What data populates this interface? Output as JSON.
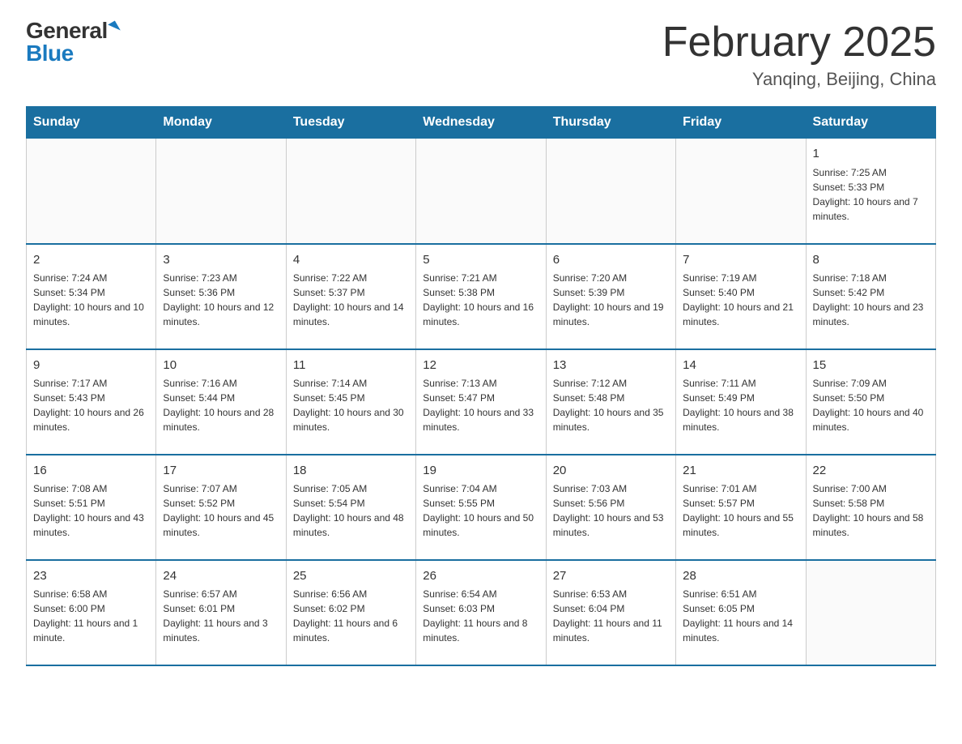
{
  "header": {
    "logo_general": "General",
    "logo_blue": "Blue",
    "month_title": "February 2025",
    "location": "Yanqing, Beijing, China"
  },
  "weekdays": [
    "Sunday",
    "Monday",
    "Tuesday",
    "Wednesday",
    "Thursday",
    "Friday",
    "Saturday"
  ],
  "weeks": [
    [
      {
        "day": "",
        "info": ""
      },
      {
        "day": "",
        "info": ""
      },
      {
        "day": "",
        "info": ""
      },
      {
        "day": "",
        "info": ""
      },
      {
        "day": "",
        "info": ""
      },
      {
        "day": "",
        "info": ""
      },
      {
        "day": "1",
        "info": "Sunrise: 7:25 AM\nSunset: 5:33 PM\nDaylight: 10 hours and 7 minutes."
      }
    ],
    [
      {
        "day": "2",
        "info": "Sunrise: 7:24 AM\nSunset: 5:34 PM\nDaylight: 10 hours and 10 minutes."
      },
      {
        "day": "3",
        "info": "Sunrise: 7:23 AM\nSunset: 5:36 PM\nDaylight: 10 hours and 12 minutes."
      },
      {
        "day": "4",
        "info": "Sunrise: 7:22 AM\nSunset: 5:37 PM\nDaylight: 10 hours and 14 minutes."
      },
      {
        "day": "5",
        "info": "Sunrise: 7:21 AM\nSunset: 5:38 PM\nDaylight: 10 hours and 16 minutes."
      },
      {
        "day": "6",
        "info": "Sunrise: 7:20 AM\nSunset: 5:39 PM\nDaylight: 10 hours and 19 minutes."
      },
      {
        "day": "7",
        "info": "Sunrise: 7:19 AM\nSunset: 5:40 PM\nDaylight: 10 hours and 21 minutes."
      },
      {
        "day": "8",
        "info": "Sunrise: 7:18 AM\nSunset: 5:42 PM\nDaylight: 10 hours and 23 minutes."
      }
    ],
    [
      {
        "day": "9",
        "info": "Sunrise: 7:17 AM\nSunset: 5:43 PM\nDaylight: 10 hours and 26 minutes."
      },
      {
        "day": "10",
        "info": "Sunrise: 7:16 AM\nSunset: 5:44 PM\nDaylight: 10 hours and 28 minutes."
      },
      {
        "day": "11",
        "info": "Sunrise: 7:14 AM\nSunset: 5:45 PM\nDaylight: 10 hours and 30 minutes."
      },
      {
        "day": "12",
        "info": "Sunrise: 7:13 AM\nSunset: 5:47 PM\nDaylight: 10 hours and 33 minutes."
      },
      {
        "day": "13",
        "info": "Sunrise: 7:12 AM\nSunset: 5:48 PM\nDaylight: 10 hours and 35 minutes."
      },
      {
        "day": "14",
        "info": "Sunrise: 7:11 AM\nSunset: 5:49 PM\nDaylight: 10 hours and 38 minutes."
      },
      {
        "day": "15",
        "info": "Sunrise: 7:09 AM\nSunset: 5:50 PM\nDaylight: 10 hours and 40 minutes."
      }
    ],
    [
      {
        "day": "16",
        "info": "Sunrise: 7:08 AM\nSunset: 5:51 PM\nDaylight: 10 hours and 43 minutes."
      },
      {
        "day": "17",
        "info": "Sunrise: 7:07 AM\nSunset: 5:52 PM\nDaylight: 10 hours and 45 minutes."
      },
      {
        "day": "18",
        "info": "Sunrise: 7:05 AM\nSunset: 5:54 PM\nDaylight: 10 hours and 48 minutes."
      },
      {
        "day": "19",
        "info": "Sunrise: 7:04 AM\nSunset: 5:55 PM\nDaylight: 10 hours and 50 minutes."
      },
      {
        "day": "20",
        "info": "Sunrise: 7:03 AM\nSunset: 5:56 PM\nDaylight: 10 hours and 53 minutes."
      },
      {
        "day": "21",
        "info": "Sunrise: 7:01 AM\nSunset: 5:57 PM\nDaylight: 10 hours and 55 minutes."
      },
      {
        "day": "22",
        "info": "Sunrise: 7:00 AM\nSunset: 5:58 PM\nDaylight: 10 hours and 58 minutes."
      }
    ],
    [
      {
        "day": "23",
        "info": "Sunrise: 6:58 AM\nSunset: 6:00 PM\nDaylight: 11 hours and 1 minute."
      },
      {
        "day": "24",
        "info": "Sunrise: 6:57 AM\nSunset: 6:01 PM\nDaylight: 11 hours and 3 minutes."
      },
      {
        "day": "25",
        "info": "Sunrise: 6:56 AM\nSunset: 6:02 PM\nDaylight: 11 hours and 6 minutes."
      },
      {
        "day": "26",
        "info": "Sunrise: 6:54 AM\nSunset: 6:03 PM\nDaylight: 11 hours and 8 minutes."
      },
      {
        "day": "27",
        "info": "Sunrise: 6:53 AM\nSunset: 6:04 PM\nDaylight: 11 hours and 11 minutes."
      },
      {
        "day": "28",
        "info": "Sunrise: 6:51 AM\nSunset: 6:05 PM\nDaylight: 11 hours and 14 minutes."
      },
      {
        "day": "",
        "info": ""
      }
    ]
  ]
}
